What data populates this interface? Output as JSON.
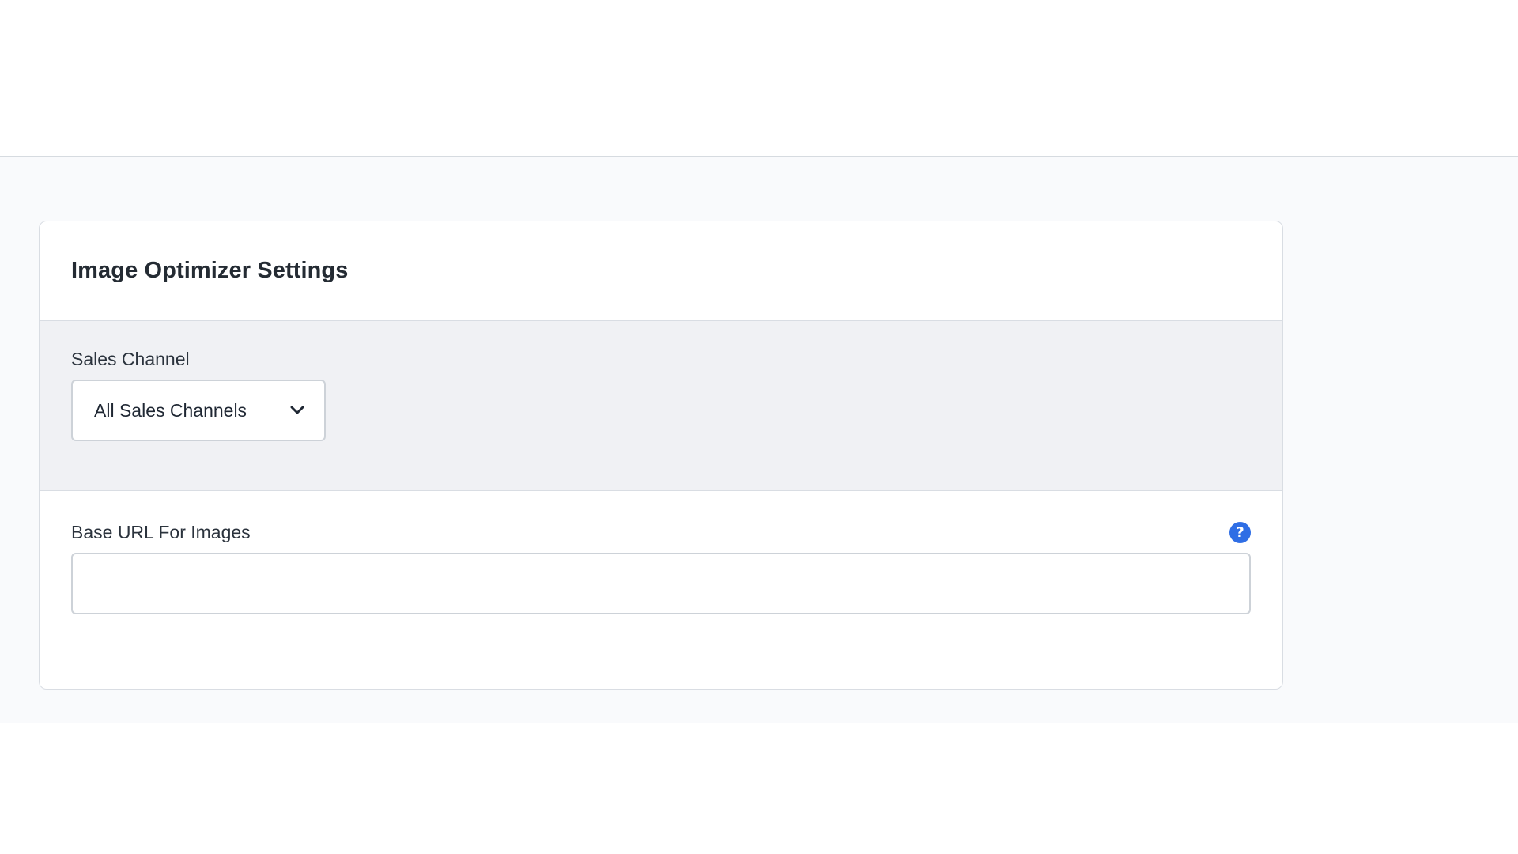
{
  "card": {
    "title": "Image Optimizer Settings"
  },
  "sales_channel": {
    "label": "Sales Channel",
    "selected": "All Sales Channels"
  },
  "base_url": {
    "label": "Base URL For Images",
    "value": "",
    "placeholder": "",
    "help_icon": "question-mark"
  },
  "colors": {
    "accent": "#2f6ee5",
    "section_bg": "#f0f1f4",
    "content_bg": "#f9fafc"
  }
}
